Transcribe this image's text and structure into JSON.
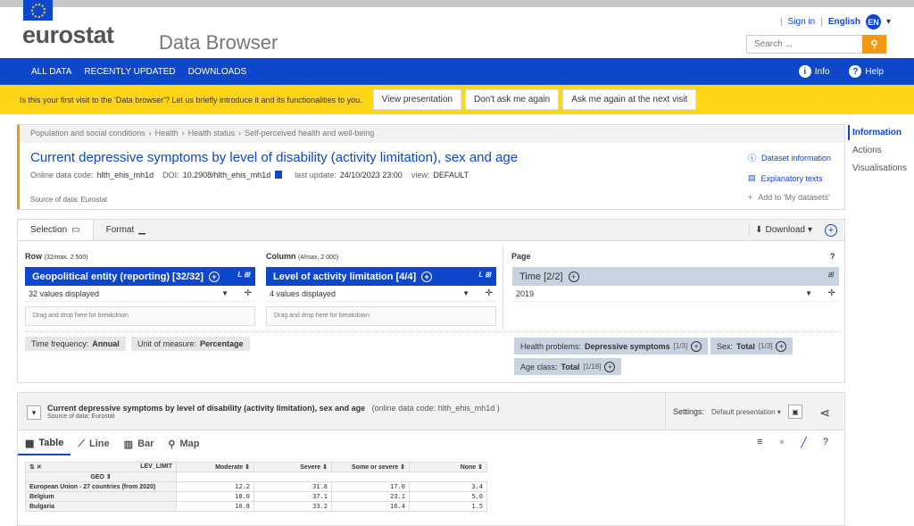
{
  "header": {
    "logo": "eurostat",
    "app_title": "Data Browser",
    "sign_in": "Sign in",
    "language": "English",
    "language_code": "EN",
    "search_placeholder": "Search ..."
  },
  "nav": {
    "items": [
      "ALL DATA",
      "RECENTLY UPDATED",
      "DOWNLOADS"
    ],
    "info": "Info",
    "help": "Help"
  },
  "banner": {
    "text": "Is this your first visit to the 'Data browser'? Let us briefly introduce it and its functionalities to you.",
    "buttons": [
      "View presentation",
      "Don't ask me again",
      "Ask me again at the next visit"
    ]
  },
  "right_nav": [
    "Information",
    "Actions",
    "Visualisations"
  ],
  "dataset": {
    "breadcrumb": [
      "Population and social conditions",
      "Health",
      "Health status",
      "Self-perceived health and well-being"
    ],
    "title": "Current depressive symptoms by level of disability (activity limitation), sex and age",
    "code_label": "Online data code:",
    "code": "hlth_ehis_mh1d",
    "doi_label": "DOI:",
    "doi": "10.2908/hlth_ehis_mh1d",
    "update_label": "last update:",
    "update": "24/10/2023 23:00",
    "view_label": "view:",
    "view": "DEFAULT",
    "source": "Source of data:  Eurostat",
    "links": [
      "Dataset information",
      "Explanatory texts",
      "Add to 'My datasets'"
    ]
  },
  "selection": {
    "tabs": [
      "Selection",
      "Format"
    ],
    "download": "Download",
    "row_label": "Row",
    "row_limit": "(32/max. 2 500)",
    "col_label": "Column",
    "col_limit": "(4/max. 2 000)",
    "page_label": "Page",
    "row_dim": "Geopolitical entity (reporting) [32/32]",
    "row_vals": "32 values displayed",
    "col_dim": "Level of activity limitation [4/4]",
    "col_vals": "4 values displayed",
    "page_dim": "Time [2/2]",
    "page_val": "2019",
    "drop_text": "Drag and drop here for breakdown",
    "chips": [
      {
        "label": "Time frequency:",
        "value": "Annual"
      },
      {
        "label": "Unit of measure:",
        "value": "Percentage"
      }
    ],
    "page_chips": [
      {
        "label": "Health problems:",
        "value": "Depressive symptoms",
        "count": "[1/3]"
      },
      {
        "label": "Sex:",
        "value": "Total",
        "count": "[1/3]"
      },
      {
        "label": "Age class:",
        "value": "Total",
        "count": "[1/18]"
      }
    ]
  },
  "view": {
    "title": "Current depressive symptoms by level of disability (activity limitation), sex and age",
    "code_text": "(online data code: hlth_ehis_mh1d )",
    "source": "Source of data: Eurostat",
    "settings_label": "Settings:",
    "settings_value": "Default presentation",
    "tabs": [
      "Table",
      "Line",
      "Bar",
      "Map"
    ]
  },
  "table": {
    "corner": "LEV_LIMIT",
    "geo_header": "GEO",
    "columns": [
      "Moderate",
      "Severe",
      "Some or severe",
      "None"
    ],
    "rows": [
      {
        "geo": "European Union - 27 countries (from 2020)",
        "values": [
          "12.2",
          "31.8",
          "17.0",
          "3.4"
        ]
      },
      {
        "geo": "Belgium",
        "values": [
          "18.0",
          "37.1",
          "23.1",
          "5.0"
        ]
      },
      {
        "geo": "Bulgaria",
        "values": [
          "10.8",
          "33.2",
          "16.4",
          "1.5"
        ]
      }
    ]
  }
}
